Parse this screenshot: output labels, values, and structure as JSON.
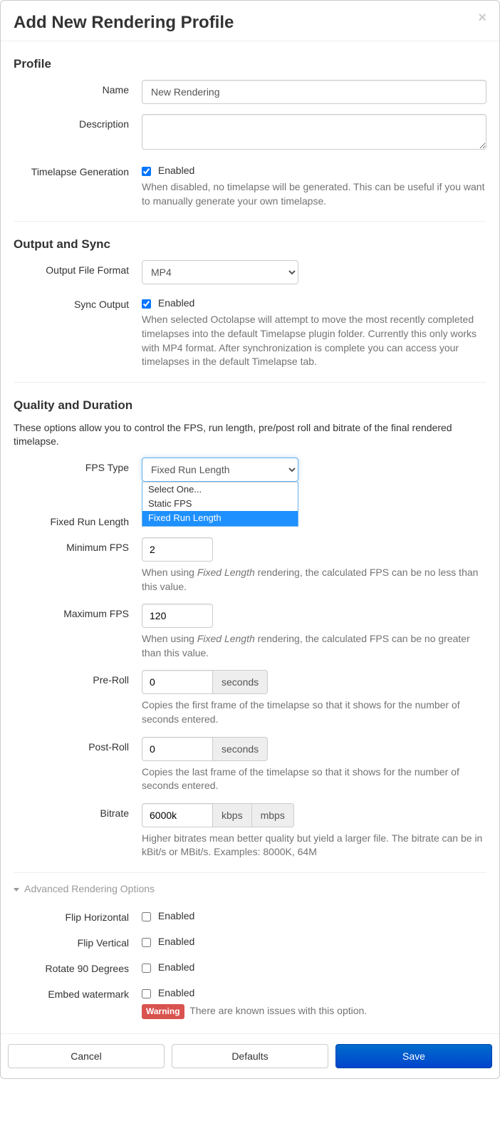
{
  "header": {
    "title": "Add New Rendering Profile",
    "close": "×"
  },
  "profile": {
    "heading": "Profile",
    "name_label": "Name",
    "name_value": "New Rendering",
    "description_label": "Description",
    "description_value": "",
    "timelapse_label": "Timelapse Generation",
    "timelapse_enabled_label": "Enabled",
    "timelapse_help": "When disabled, no timelapse will be generated. This can be useful if you want to manually generate your own timelapse."
  },
  "output": {
    "heading": "Output and Sync",
    "format_label": "Output File Format",
    "format_value": "MP4",
    "sync_label": "Sync Output",
    "sync_enabled_label": "Enabled",
    "sync_help": "When selected Octolapse will attempt to move the most recently completed timelapses into the default Timelapse plugin folder. Currently this only works with MP4 format. After synchronization is complete you can access your timelapses in the default Timelapse tab."
  },
  "quality": {
    "heading": "Quality and Duration",
    "desc": "These options allow you to control the FPS, run length, pre/post roll and bitrate of the final rendered timelapse.",
    "fps_type_label": "FPS Type",
    "fps_type_value": "Fixed Run Length",
    "fps_type_options": [
      "Select One...",
      "Static FPS",
      "Fixed Run Length"
    ],
    "fixed_run_label": "Fixed Run Length",
    "min_fps_label": "Minimum FPS",
    "min_fps_value": "2",
    "min_fps_help_pre": "When using ",
    "min_fps_help_em": "Fixed Length",
    "min_fps_help_post": " rendering, the calculated FPS can be no less than this value.",
    "max_fps_label": "Maximum FPS",
    "max_fps_value": "120",
    "max_fps_help_pre": "When using ",
    "max_fps_help_em": "Fixed Length",
    "max_fps_help_post": " rendering, the calculated FPS can be no greater than this value.",
    "preroll_label": "Pre-Roll",
    "preroll_value": "0",
    "preroll_unit": "seconds",
    "preroll_help": "Copies the first frame of the timelapse so that it shows for the number of seconds entered.",
    "postroll_label": "Post-Roll",
    "postroll_value": "0",
    "postroll_unit": "seconds",
    "postroll_help": "Copies the last frame of the timelapse so that it shows for the number of seconds entered.",
    "bitrate_label": "Bitrate",
    "bitrate_value": "6000k",
    "bitrate_unit1": "kbps",
    "bitrate_unit2": "mbps",
    "bitrate_help": "Higher bitrates mean better quality but yield a larger file. The bitrate can be in kBit/s or MBit/s. Examples: 8000K, 64M"
  },
  "advanced": {
    "heading": "Advanced Rendering Options",
    "flip_h_label": "Flip Horizontal",
    "flip_h_enabled": "Enabled",
    "flip_v_label": "Flip Vertical",
    "flip_v_enabled": "Enabled",
    "rotate_label": "Rotate 90 Degrees",
    "rotate_enabled": "Enabled",
    "watermark_label": "Embed watermark",
    "watermark_enabled": "Enabled",
    "watermark_warn_badge": "Warning",
    "watermark_warn_text": "There are known issues with this option."
  },
  "footer": {
    "cancel": "Cancel",
    "defaults": "Defaults",
    "save": "Save"
  }
}
